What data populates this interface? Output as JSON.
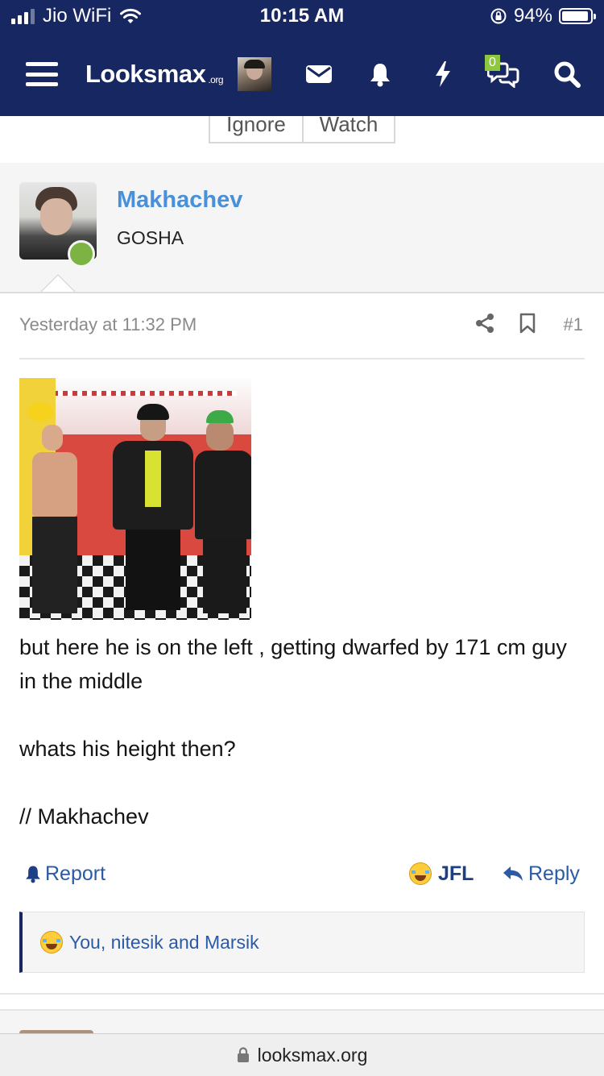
{
  "status_bar": {
    "carrier": "Jio WiFi",
    "time": "10:15 AM",
    "battery_percent": "94%",
    "battery_level": 0.94,
    "icons": [
      "signal-icon",
      "wifi-icon",
      "orientation-lock-icon",
      "battery-icon"
    ]
  },
  "navbar": {
    "logo_text": "Looksmax",
    "logo_suffix": ".org",
    "icons": [
      "menu-icon",
      "avatar",
      "mail-icon",
      "bell-icon",
      "bolt-icon",
      "chat-icon",
      "search-icon"
    ],
    "chat_badge": "0",
    "colors": {
      "background": "#172761",
      "badge": "#8dc63f"
    }
  },
  "thread_actions": {
    "ignore_label": "Ignore",
    "watch_label": "Watch"
  },
  "post": {
    "author": "Makhachev",
    "user_title": "GOSHA",
    "date": "Yesterday at 11:32 PM",
    "number": "#1",
    "body": [
      "but here he is on the left , getting dwarfed by 171 cm guy in the middle",
      "whats his height then?",
      "// Makhachev"
    ],
    "actions": {
      "report": "Report",
      "reaction": "JFL",
      "reply": "Reply"
    },
    "reactions_summary": "You, nitesik and Marsik",
    "colors": {
      "author": "#4a90d9",
      "link": "#2b5aa6",
      "online": "#7cb342"
    }
  },
  "browser": {
    "url": "looksmax.org"
  }
}
